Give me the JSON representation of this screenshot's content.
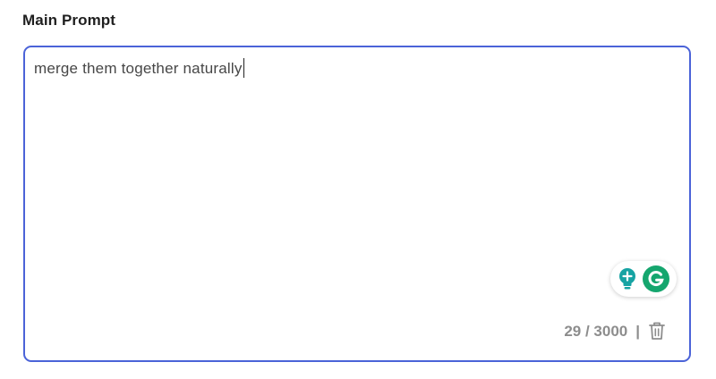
{
  "field": {
    "label": "Main Prompt",
    "value": "merge them together naturally"
  },
  "counter": {
    "text": "29 / 3000",
    "separator": "|"
  },
  "assist": {
    "icons": [
      "lightbulb-icon",
      "grammarly-icon"
    ]
  },
  "colors": {
    "border_focus": "#4b63d8",
    "grammarly_green": "#15a66e",
    "bulb_teal": "#16a3a3",
    "counter_gray": "#8d8d8d"
  }
}
